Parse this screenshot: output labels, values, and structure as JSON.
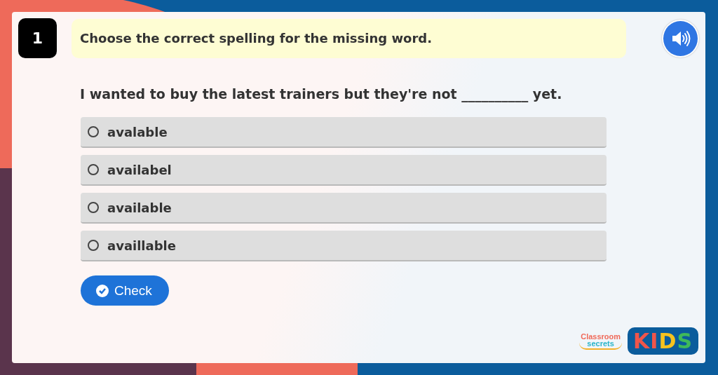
{
  "question_number": "1",
  "instruction": "Choose the correct spelling for the missing word.",
  "question": "I wanted to buy the latest trainers but they're not __________ yet.",
  "options": [
    {
      "label": "avalable",
      "selected": false
    },
    {
      "label": "availabel",
      "selected": false
    },
    {
      "label": "available",
      "selected": false
    },
    {
      "label": "availlable",
      "selected": false
    }
  ],
  "check_button": "Check",
  "logo": {
    "classroom": "Classroom",
    "secrets": "secrets",
    "kids": "KIDS"
  }
}
